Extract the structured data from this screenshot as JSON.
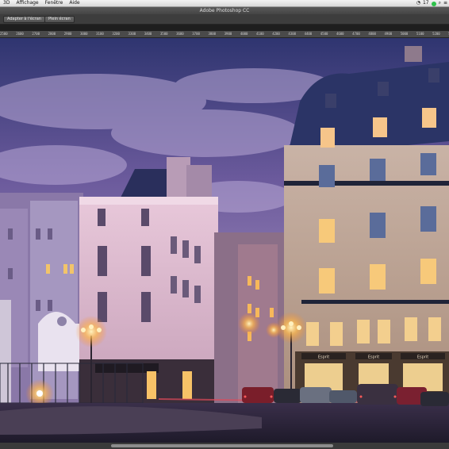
{
  "menubar": {
    "items": [
      "3D",
      "Affichage",
      "Fenêtre",
      "Aide"
    ],
    "status_time": "17"
  },
  "titlebar": {
    "title": "Adobe Photoshop CC"
  },
  "options": {
    "fit_screen": "Adapter à l'écran",
    "full_screen": "Plein écran"
  },
  "ruler": {
    "ticks": [
      "2500",
      "2600",
      "2700",
      "2800",
      "2900",
      "3000",
      "3100",
      "3200",
      "3300",
      "3400",
      "3500",
      "3600",
      "3700",
      "3800",
      "3900",
      "4000",
      "4100",
      "4200",
      "4300",
      "4400",
      "4500",
      "4600",
      "4700",
      "4800",
      "4900",
      "5000",
      "5100",
      "5200",
      "5300",
      "5400",
      "5500",
      "5600",
      "5700",
      "5800",
      "5900",
      "6000",
      "6100",
      "6200",
      "6300",
      "6400",
      "6500",
      "6600",
      "6700"
    ]
  },
  "photo": {
    "shop_signs": [
      "Esprit",
      "Esprit",
      "Esprit"
    ],
    "colors": {
      "sky_top": "#3a3f7a",
      "sky_mid": "#6a5a9a",
      "building": "#d9b7c9",
      "street_light": "#ffd27a"
    }
  }
}
